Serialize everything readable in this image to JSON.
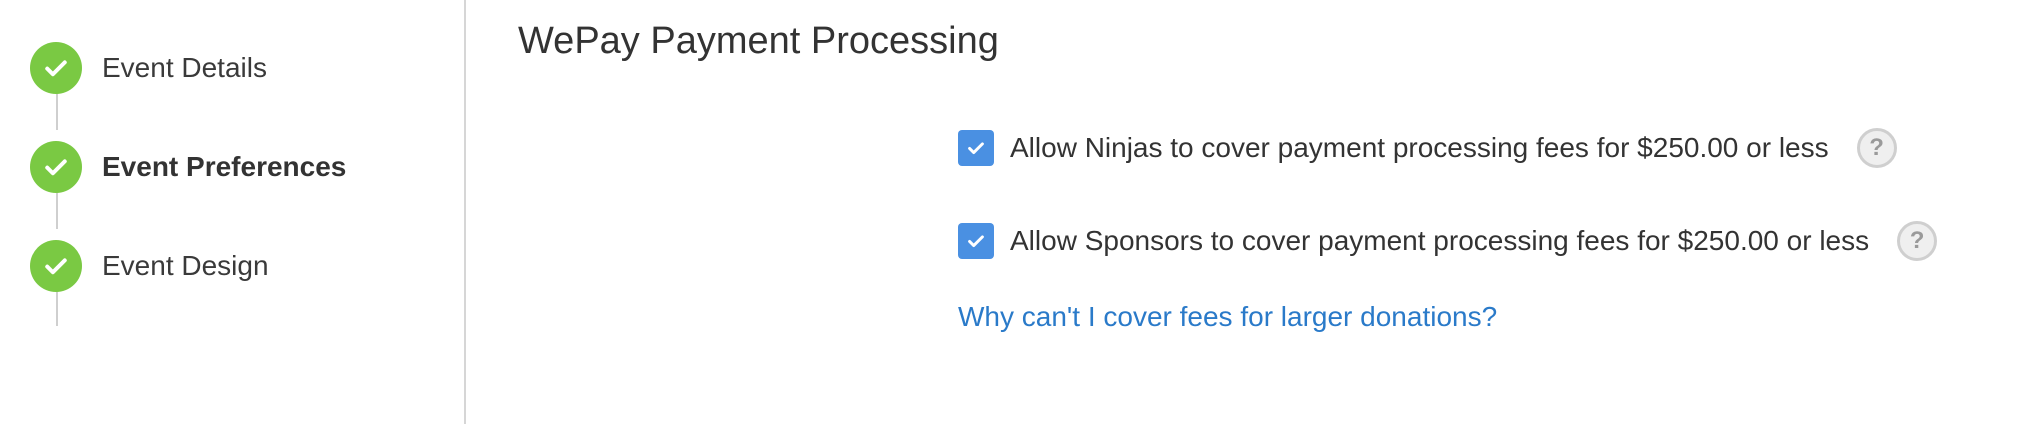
{
  "sidebar": {
    "steps": [
      {
        "label": "Event Details",
        "status": "complete",
        "icon": "check-icon"
      },
      {
        "label": "Event Preferences",
        "status": "current",
        "icon": "check-icon"
      },
      {
        "label": "Event Design",
        "status": "complete",
        "icon": "check-icon"
      }
    ]
  },
  "main": {
    "title": "WePay Payment Processing",
    "options": [
      {
        "label": "Allow Ninjas to cover payment processing fees for $250.00 or less",
        "checked": true,
        "help_icon": "?"
      },
      {
        "label": "Allow Sponsors to cover payment processing fees for $250.00 or less",
        "checked": true,
        "help_icon": "?"
      }
    ],
    "help_link": "Why can't I cover fees for larger donations?"
  },
  "colors": {
    "step_complete": "#7ac943",
    "checkbox": "#4a90e2",
    "link": "#2a7ac9"
  }
}
